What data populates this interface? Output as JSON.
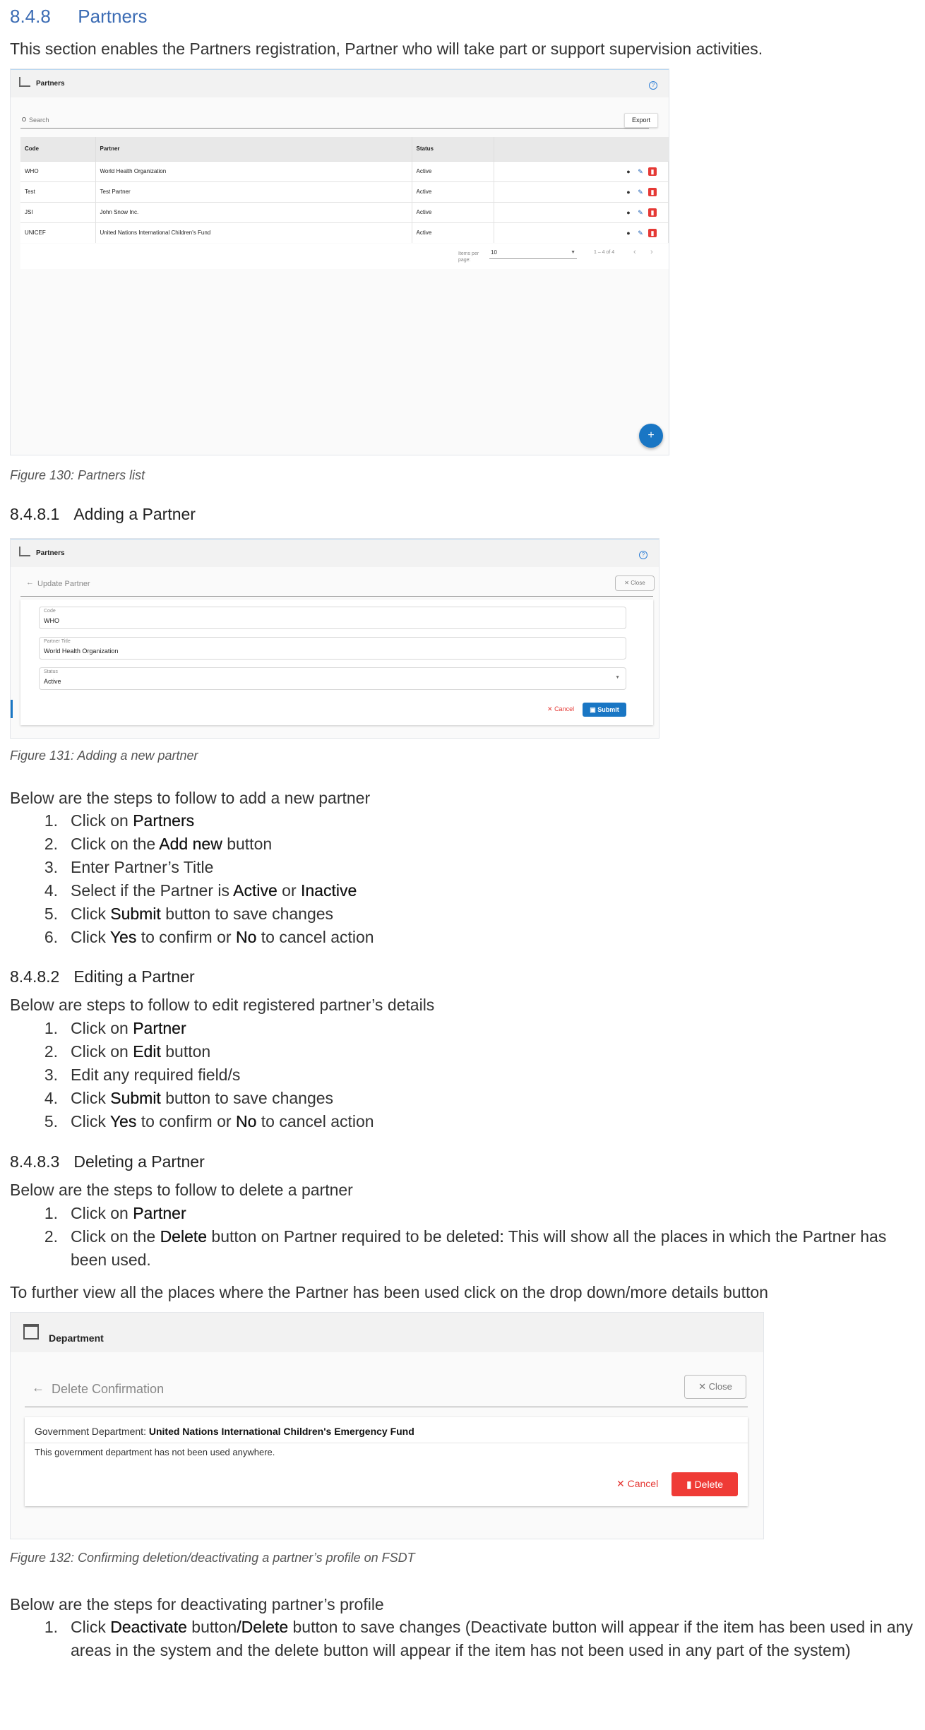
{
  "section": {
    "number": "8.4.8",
    "title": "Partners"
  },
  "intro": "This section enables the Partners registration, Partner who will take part or support supervision activities.",
  "fig130": {
    "app_title": "Partners",
    "help": "?",
    "search_placeholder": "Search",
    "export_label": "Export",
    "columns": [
      "Code",
      "Partner",
      "Status"
    ],
    "rows": [
      {
        "code": "WHO",
        "partner": "World Health Organization",
        "status": "Active"
      },
      {
        "code": "Test",
        "partner": "Test Partner",
        "status": "Active"
      },
      {
        "code": "JSI",
        "partner": "John Snow Inc.",
        "status": "Active"
      },
      {
        "code": "UNICEF",
        "partner": "United Nations International Children's Fund",
        "status": "Active"
      }
    ],
    "items_per_page_label": "Items per page:",
    "items_per_page_value": "10",
    "range": "1 – 4 of 4",
    "fab": "+",
    "caption": "Figure 130: Partners list"
  },
  "sub1": {
    "number": "8.4.8.1",
    "title": "Adding a Partner"
  },
  "fig131": {
    "app_title": "Partners",
    "help": "?",
    "form_title": "Update Partner",
    "close_label": "Close",
    "code_label": "Code",
    "code_value": "WHO",
    "title_label": "Partner Title",
    "title_value": "World Health Organization",
    "status_label": "Status",
    "status_value": "Active",
    "cancel_label": "Cancel",
    "submit_label": "Submit",
    "caption": "Figure 131: Adding a new partner"
  },
  "add_intro": "Below are the steps to follow to add a new partner",
  "add_steps": [
    {
      "n": "1.",
      "a": "Click on ",
      "b": "Partners",
      "c": ""
    },
    {
      "n": "2.",
      "a": "Click on the ",
      "b": "Add new",
      "c": " button"
    },
    {
      "n": "3.",
      "a": "Enter Partner’s Title",
      "b": "",
      "c": ""
    },
    {
      "n": "4.",
      "a": "Select if the Partner is ",
      "b": "Active",
      "c": " or ",
      "d": "Inactive"
    },
    {
      "n": "5.",
      "a": "Click ",
      "b": "Submit",
      "c": " button to save changes"
    },
    {
      "n": "6.",
      "a": "Click ",
      "b": "Yes",
      "c": " to confirm or ",
      "d": "No",
      "e": " to cancel action"
    }
  ],
  "sub2": {
    "number": "8.4.8.2",
    "title": "Editing a Partner"
  },
  "edit_intro": "Below are steps to follow to edit registered partner’s details",
  "edit_steps": [
    {
      "n": "1.",
      "a": "Click on ",
      "b": "Partner",
      "c": ""
    },
    {
      "n": "2.",
      "a": "Click on ",
      "b": "Edit",
      "c": " button"
    },
    {
      "n": "3.",
      "a": "Edit any required field/s",
      "b": "",
      "c": ""
    },
    {
      "n": "4.",
      "a": "Click ",
      "b": "Submit",
      "c": " button to save changes"
    },
    {
      "n": "5.",
      "a": "Click ",
      "b": "Yes",
      "c": " to confirm or ",
      "d": "No",
      "e": " to cancel action"
    }
  ],
  "sub3": {
    "number": "8.4.8.3",
    "title": "Deleting a Partner"
  },
  "delete_intro": "Below are the steps to follow to delete a partner",
  "delete_steps": [
    {
      "n": "1.",
      "a": "Click on ",
      "b": "Partner",
      "c": ""
    },
    {
      "n": "2.",
      "a": "Click on the ",
      "b": "Delete",
      "c": " button on Partner required to be deleted",
      "d": ":",
      "e": " This will show all the places in which the Partner has been used."
    }
  ],
  "further_view": "To further view all the places where the Partner has been used click on the drop down/more details button",
  "fig132": {
    "app_title": "Department",
    "form_title": "Delete Confirmation",
    "close_label": "Close",
    "dept_label": "Government Department: ",
    "dept_value": "United Nations International Children's Emergency Fund",
    "note": "This government department has not been used anywhere.",
    "cancel_label": "Cancel",
    "delete_label": "Delete",
    "caption": "Figure 132: Confirming deletion/deactivating a partner’s profile on FSDT"
  },
  "deact_intro": "Below are the steps for deactivating partner’s profile",
  "deact_steps": [
    {
      "n": "1.",
      "a": "Click ",
      "b": "Deactivate",
      "c": " button",
      "d": "/Delete",
      "e": " button to save changes (Deactivate button will appear if the item has been used in any areas in the system and the delete button will appear if the item has not been used in any part of the system)"
    }
  ]
}
